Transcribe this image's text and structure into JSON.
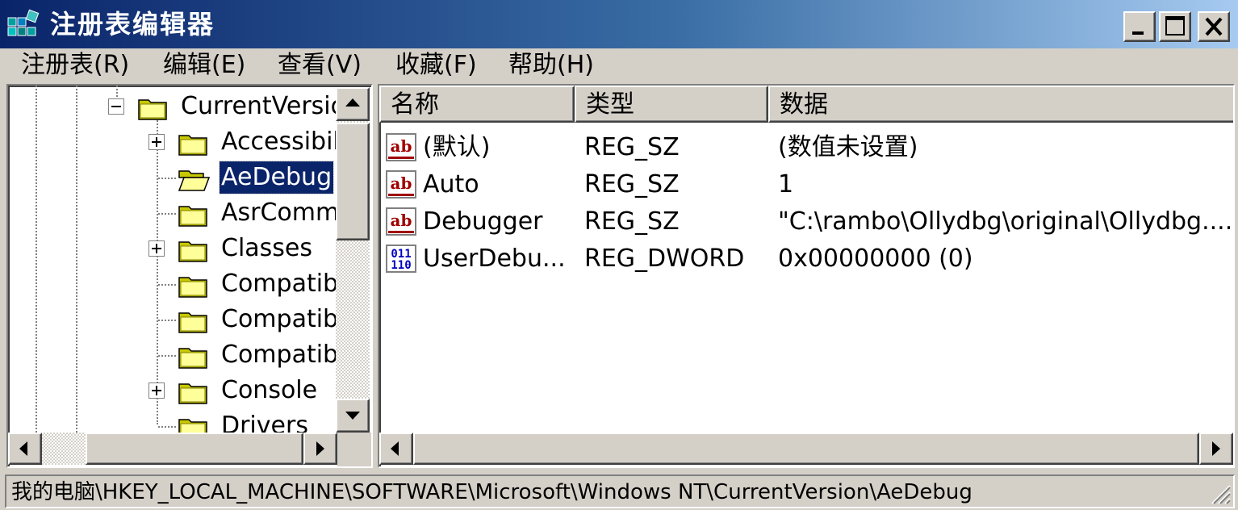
{
  "window": {
    "title": "注册表编辑器",
    "icon": "regedit-icon",
    "controls": {
      "minimize": "minimize-icon",
      "maximize": "maximize-icon",
      "close": "close-icon"
    }
  },
  "menu": [
    {
      "label": "注册表(R)"
    },
    {
      "label": "编辑(E)"
    },
    {
      "label": "查看(V)"
    },
    {
      "label": "收藏(F)"
    },
    {
      "label": "帮助(H)"
    }
  ],
  "tree": {
    "items": [
      {
        "label": "CurrentVersio",
        "expander": "minus"
      },
      {
        "label": "Accessibili",
        "expander": "plus"
      },
      {
        "label": "AeDebug",
        "expander": "none",
        "selected": true
      },
      {
        "label": "AsrComm",
        "expander": "none"
      },
      {
        "label": "Classes",
        "expander": "plus"
      },
      {
        "label": "Compatibi",
        "expander": "none"
      },
      {
        "label": "Compatibi",
        "expander": "none"
      },
      {
        "label": "Compatibi",
        "expander": "none"
      },
      {
        "label": "Console",
        "expander": "plus"
      },
      {
        "label": "Drivers",
        "expander": "none"
      }
    ]
  },
  "list": {
    "columns": [
      "名称",
      "类型",
      "数据"
    ],
    "rows": [
      {
        "icon": "string-value-icon",
        "name": "(默认)",
        "type": "REG_SZ",
        "data": "(数值未设置)"
      },
      {
        "icon": "string-value-icon",
        "name": "Auto",
        "type": "REG_SZ",
        "data": "1"
      },
      {
        "icon": "string-value-icon",
        "name": "Debugger",
        "type": "REG_SZ",
        "data": "\"C:\\rambo\\Ollydbg\\original\\Ollydbg...."
      },
      {
        "icon": "binary-value-icon",
        "name": "UserDebu...",
        "type": "REG_DWORD",
        "data": "0x00000000 (0)"
      }
    ]
  },
  "statusbar": {
    "path": "我的电脑\\HKEY_LOCAL_MACHINE\\SOFTWARE\\Microsoft\\Windows NT\\CurrentVersion\\AeDebug"
  },
  "colors": {
    "titlebar_start": "#0a246a",
    "titlebar_end": "#a6caf0",
    "face": "#d4d0c8",
    "selection": "#0a246a",
    "folder": "#ffff99"
  }
}
